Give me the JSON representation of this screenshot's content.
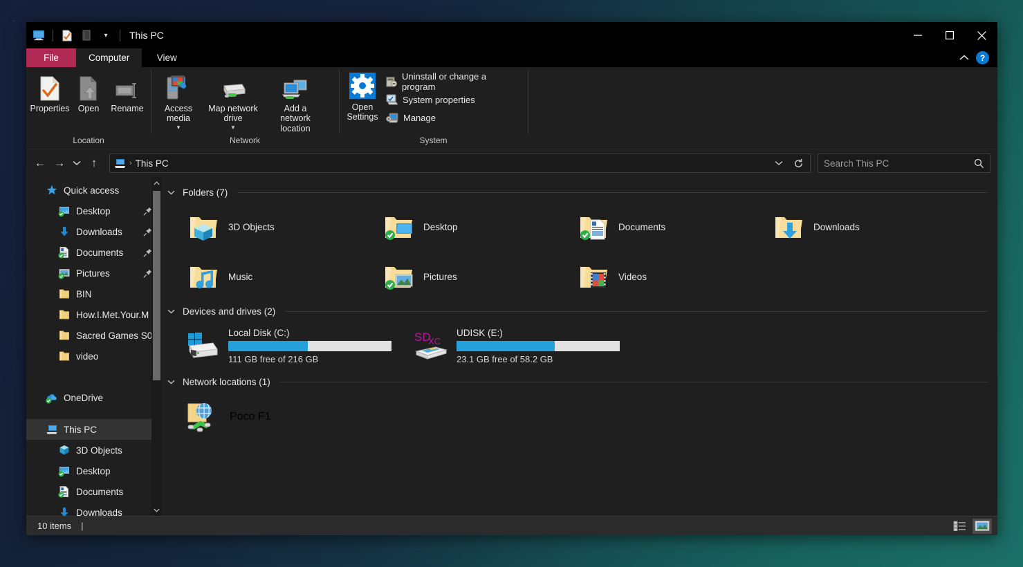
{
  "window": {
    "title": "This PC",
    "minimize_label": "—",
    "maximize_label": "□",
    "close_label": "✕",
    "ribbon_collapse_label": "⌃",
    "help_label": "?"
  },
  "quick_access_toolbar": {
    "items": [
      {
        "name": "this-pc-icon",
        "label": ""
      },
      {
        "name": "properties-icon",
        "label": ""
      },
      {
        "name": "folder-icon",
        "label": ""
      },
      {
        "name": "customize-dropdown",
        "label": "▾"
      }
    ]
  },
  "tabs": [
    {
      "id": "file",
      "label": "File"
    },
    {
      "id": "computer",
      "label": "Computer"
    },
    {
      "id": "view",
      "label": "View"
    }
  ],
  "active_tab": "computer",
  "ribbon": {
    "groups": [
      {
        "name": "Location",
        "buttons": [
          {
            "label": "Properties",
            "icon": "properties-icon",
            "dropdown": false
          },
          {
            "label": "Open",
            "icon": "open-icon",
            "dropdown": false
          },
          {
            "label": "Rename",
            "icon": "rename-icon",
            "dropdown": false
          }
        ]
      },
      {
        "name": "Network",
        "buttons": [
          {
            "label": "Access media",
            "icon": "access-media-icon",
            "dropdown": true
          },
          {
            "label": "Map network drive",
            "icon": "map-network-drive-icon",
            "dropdown": true
          },
          {
            "label": "Add a network location",
            "icon": "add-network-location-icon",
            "dropdown": false
          }
        ]
      },
      {
        "name": "System",
        "buttons": [
          {
            "label": "Open Settings",
            "icon": "settings-gear-icon",
            "dropdown": false
          }
        ],
        "small_buttons": [
          {
            "label": "Uninstall or change a program",
            "icon": "uninstall-program-icon"
          },
          {
            "label": "System properties",
            "icon": "system-properties-icon"
          },
          {
            "label": "Manage",
            "icon": "manage-icon"
          }
        ]
      }
    ]
  },
  "address_bar": {
    "back_label": "←",
    "forward_label": "→",
    "recent_label": "⌄",
    "up_label": "↑",
    "breadcrumb": [
      "This PC"
    ],
    "crumb_separator": "›",
    "dropdown_label": "⌄",
    "refresh_label": "↻"
  },
  "search": {
    "placeholder": "Search This PC",
    "value": "",
    "icon": "search-icon"
  },
  "nav_pane": {
    "scroll_up_label": "⌃",
    "scroll_down_label": "⌄",
    "items": [
      {
        "label": "Quick access",
        "icon": "star-icon",
        "indent": 0,
        "pin": false,
        "selected": false
      },
      {
        "label": "Desktop",
        "icon": "desktop-icon",
        "indent": 1,
        "pin": true,
        "selected": false
      },
      {
        "label": "Downloads",
        "icon": "downloads-icon",
        "indent": 1,
        "pin": true,
        "selected": false
      },
      {
        "label": "Documents",
        "icon": "documents-icon",
        "indent": 1,
        "pin": true,
        "selected": false
      },
      {
        "label": "Pictures",
        "icon": "pictures-icon",
        "indent": 1,
        "pin": true,
        "selected": false
      },
      {
        "label": "BIN",
        "icon": "folder-icon",
        "indent": 1,
        "pin": false,
        "selected": false
      },
      {
        "label": "How.I.Met.Your.M",
        "icon": "folder-icon",
        "indent": 1,
        "pin": false,
        "selected": false
      },
      {
        "label": "Sacred Games S0",
        "icon": "folder-icon",
        "indent": 1,
        "pin": false,
        "selected": false
      },
      {
        "label": "video",
        "icon": "folder-icon",
        "indent": 1,
        "pin": false,
        "selected": false
      },
      {
        "label": "",
        "icon": "spacer",
        "indent": 0,
        "pin": false,
        "selected": false
      },
      {
        "label": "OneDrive",
        "icon": "onedrive-icon",
        "indent": 0,
        "pin": false,
        "selected": false
      },
      {
        "label": "",
        "icon": "spacer",
        "indent": 0,
        "pin": false,
        "selected": false
      },
      {
        "label": "This PC",
        "icon": "this-pc-icon",
        "indent": 0,
        "pin": false,
        "selected": true
      },
      {
        "label": "3D Objects",
        "icon": "3d-objects-icon",
        "indent": 1,
        "pin": false,
        "selected": false
      },
      {
        "label": "Desktop",
        "icon": "desktop-icon",
        "indent": 1,
        "pin": false,
        "selected": false
      },
      {
        "label": "Documents",
        "icon": "documents-icon",
        "indent": 1,
        "pin": false,
        "selected": false
      },
      {
        "label": "Downloads",
        "icon": "downloads-icon",
        "indent": 1,
        "pin": false,
        "selected": false
      }
    ],
    "pin_glyph": "📌"
  },
  "content": {
    "groups": [
      {
        "id": "folders",
        "title": "Folders (7)",
        "chevron": "⌄",
        "items": [
          {
            "name": "3D Objects",
            "icon": "folder-3d-objects-icon",
            "cloud": false
          },
          {
            "name": "Desktop",
            "icon": "folder-desktop-icon",
            "cloud": true
          },
          {
            "name": "Documents",
            "icon": "folder-documents-icon",
            "cloud": true
          },
          {
            "name": "Downloads",
            "icon": "folder-downloads-icon",
            "cloud": false
          },
          {
            "name": "Music",
            "icon": "folder-music-icon",
            "cloud": false
          },
          {
            "name": "Pictures",
            "icon": "folder-pictures-icon",
            "cloud": true
          },
          {
            "name": "Videos",
            "icon": "folder-videos-icon",
            "cloud": false
          }
        ]
      },
      {
        "id": "devices",
        "title": "Devices and drives (2)",
        "chevron": "⌄",
        "drives": [
          {
            "name": "Local Disk (C:)",
            "icon": "local-disk-icon",
            "free_text": "111 GB free of 216 GB",
            "free_gb": 111,
            "total_gb": 216,
            "used_percent": 48.6,
            "bar_color": "#26a0da"
          },
          {
            "name": "UDISK (E:)",
            "icon": "sdxc-card-icon",
            "free_text": "23.1 GB free of 58.2 GB",
            "free_gb": 23.1,
            "total_gb": 58.2,
            "used_percent": 60.3,
            "bar_color": "#26a0da"
          }
        ]
      },
      {
        "id": "network",
        "title": "Network locations (1)",
        "chevron": "⌄",
        "items": [
          {
            "name": "Poco F1",
            "icon": "network-location-icon"
          }
        ]
      }
    ]
  },
  "status_bar": {
    "item_count": "10 items",
    "separator": "|",
    "views": [
      {
        "id": "details-view",
        "icon": "details-view-icon",
        "selected": false
      },
      {
        "id": "large-icons-view",
        "icon": "large-icons-view-icon",
        "selected": true
      }
    ]
  },
  "colors": {
    "accent": "#26a0da",
    "file_tab": "#b02a55",
    "window_bg": "#1f1f1f",
    "titlebar_bg": "#000000",
    "selection": "#333333",
    "help_blue": "#0a7bd4"
  }
}
